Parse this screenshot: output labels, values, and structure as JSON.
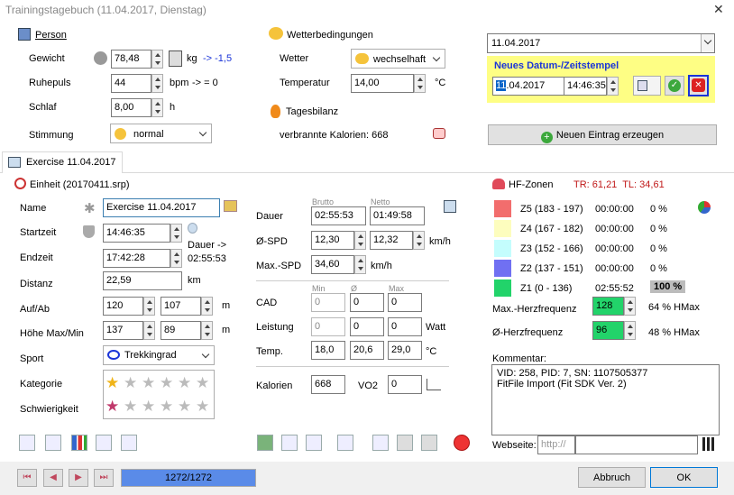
{
  "window": {
    "title": "Trainingstagebuch (11.04.2017, Dienstag)",
    "close": "✕"
  },
  "person": {
    "title": "Person",
    "gewicht_label": "Gewicht",
    "gewicht": "78,48",
    "gewicht_unit": "kg",
    "gewicht_delta": "-> -1,5",
    "ruhepuls_label": "Ruhepuls",
    "ruhepuls": "44",
    "ruhepuls_unit": "bpm",
    "ruhepuls_delta": "-> = 0",
    "schlaf_label": "Schlaf",
    "schlaf": "8,00",
    "schlaf_unit": "h",
    "stimmung_label": "Stimmung",
    "stimmung": "normal"
  },
  "wetter": {
    "title": "Wetterbedingungen",
    "wetter_label": "Wetter",
    "wetter": "wechselhaft",
    "temp_label": "Temperatur",
    "temp": "14,00",
    "temp_unit": "°C"
  },
  "tagesbilanz": {
    "title": "Tagesbilanz",
    "kalorien": "verbrannte Kalorien: 668"
  },
  "datum": {
    "selected": "11.04.2017",
    "neues_title": "Neues Datum-/Zeitstempel",
    "date_sel": "11",
    "date_rest": ".04.2017",
    "time": "14:46:35",
    "neuer_eintrag": "Neuen Eintrag erzeugen"
  },
  "tab": {
    "label": "Exercise 11.04.2017"
  },
  "einheit": {
    "title": "Einheit (20170411.srp)",
    "name_label": "Name",
    "name": "Exercise 11.04.2017",
    "startzeit_label": "Startzeit",
    "startzeit": "14:46:35",
    "endzeit_label": "Endzeit",
    "endzeit": "17:42:28",
    "dauer_arrow": "Dauer ->",
    "dauer_value": "02:55:53",
    "distanz_label": "Distanz",
    "distanz": "22,59",
    "distanz_unit": "km",
    "aufab_label": "Auf/Ab",
    "auf": "120",
    "ab": "107",
    "hoehe_label": "Höhe Max/Min",
    "hoehe_max": "137",
    "hoehe_min": "89",
    "m_unit": "m",
    "sport_label": "Sport",
    "sport": "Trekkingrad",
    "kategorie_label": "Kategorie",
    "schwierigkeit_label": "Schwierigkeit",
    "kategorie_stars": 1,
    "schwierigkeit_stars": 1
  },
  "werte": {
    "brutto": "Brutto",
    "netto": "Netto",
    "dauer_label": "Dauer",
    "dauer_brutto": "02:55:53",
    "dauer_netto": "01:49:58",
    "spd_label": "Ø-SPD",
    "spd_brutto": "12,30",
    "spd_netto": "12,32",
    "spd_unit": "km/h",
    "maxspd_label": "Max.-SPD",
    "maxspd": "34,60",
    "maxspd_unit": "km/h",
    "min_h": "Min",
    "avg_h": "Ø",
    "max_h": "Max",
    "cad_label": "CAD",
    "cad_min": "0",
    "cad_avg": "0",
    "cad_max": "0",
    "leistung_label": "Leistung",
    "leistung_min": "0",
    "leistung_avg": "0",
    "leistung_max": "0",
    "leistung_unit": "Watt",
    "temp_label": "Temp.",
    "temp_min": "18,0",
    "temp_avg": "20,6",
    "temp_max": "29,0",
    "temp_unit": "°C",
    "kalorien_label": "Kalorien",
    "kalorien": "668",
    "vo2_label": "VO2",
    "vo2": "0"
  },
  "hf": {
    "title": "HF-Zonen",
    "tr": "TR: 61,21  TL: 34,61",
    "zones": [
      {
        "label": "Z5 (183 - 197)",
        "time": "00:00:00",
        "pct": "0 %",
        "color": "#f26d6d"
      },
      {
        "label": "Z4 (167 - 182)",
        "time": "00:00:00",
        "pct": "0 %",
        "color": "#fdfdbe"
      },
      {
        "label": "Z3 (152 - 166)",
        "time": "00:00:00",
        "pct": "0 %",
        "color": "#c4fdfd"
      },
      {
        "label": "Z2 (137 - 151)",
        "time": "00:00:00",
        "pct": "0 %",
        "color": "#7070f2"
      },
      {
        "label": "Z1 (0 - 136)",
        "time": "02:55:52",
        "pct": "100 %",
        "color": "#22d36a"
      }
    ],
    "maxhf_label": "Max.-Herzfrequenz",
    "maxhf": "128",
    "maxhf_pct": "64 % HMax",
    "avghf_label": "Ø-Herzfrequenz",
    "avghf": "96",
    "avghf_pct": "48 % HMax",
    "kommentar_label": "Kommentar:",
    "kommentar_line1": "VID: 258, PID: 7, SN: 1107505377",
    "kommentar_line2": "FitFile Import (Fit SDK Ver. 2)",
    "webseite_label": "Webseite:",
    "webseite_placeholder": "http://"
  },
  "nav": {
    "counter": "1272/1272",
    "progress": 1.0,
    "abbruch": "Abbruch",
    "ok": "OK"
  }
}
